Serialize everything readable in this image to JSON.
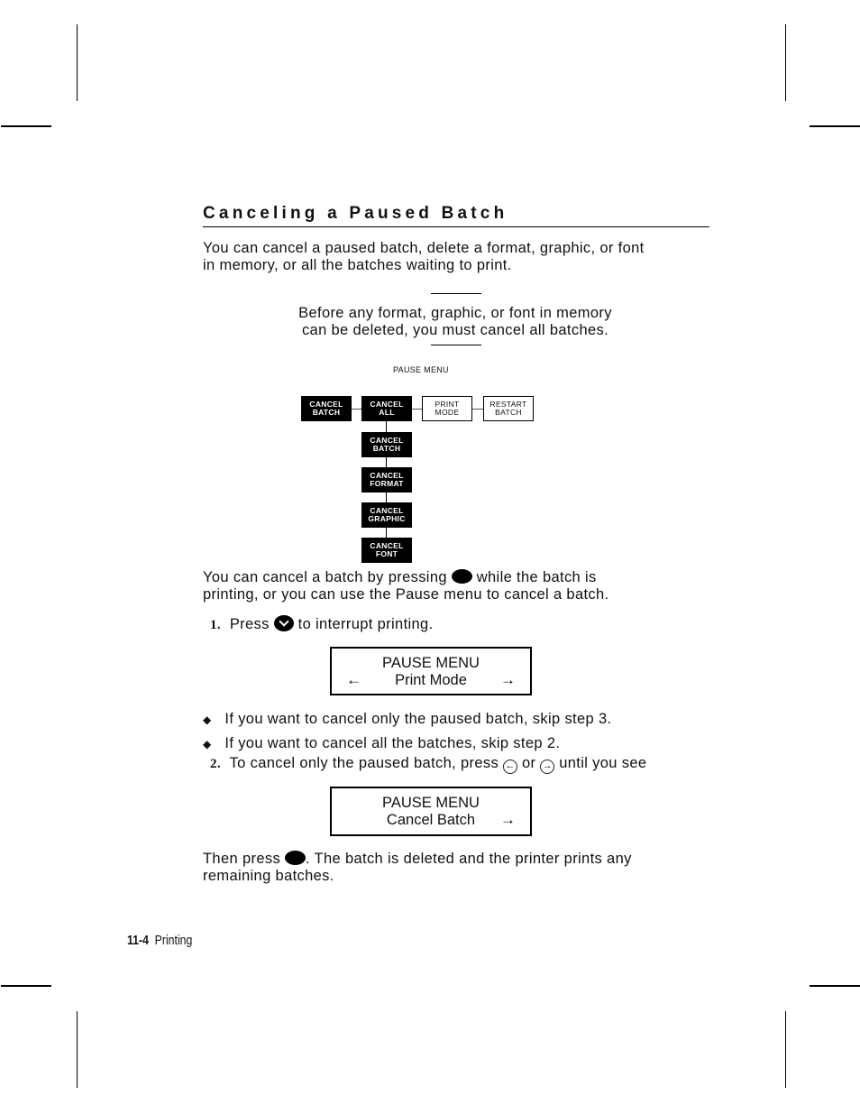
{
  "section": {
    "title": "Canceling a Paused Batch",
    "intro_line1": "You can cancel a paused batch, delete a format, graphic, or font",
    "intro_line2": "in memory, or all the batches waiting to print."
  },
  "note": {
    "line1": "Before any format, graphic, or font in memory",
    "line2": "can be deleted, you must cancel all batches."
  },
  "diagram": {
    "title": "PAUSE MENU",
    "top_row": [
      {
        "line1": "CANCEL",
        "line2": "BATCH",
        "style": "dark"
      },
      {
        "line1": "CANCEL",
        "line2": "ALL",
        "style": "dark"
      },
      {
        "line1": "PRINT",
        "line2": "MODE",
        "style": "light"
      },
      {
        "line1": "RESTART",
        "line2": "BATCH",
        "style": "light"
      }
    ],
    "sub_items": [
      {
        "line1": "CANCEL",
        "line2": "BATCH"
      },
      {
        "line1": "CANCEL",
        "line2": "FORMAT"
      },
      {
        "line1": "CANCEL",
        "line2": "GRAPHIC"
      },
      {
        "line1": "CANCEL",
        "line2": "FONT"
      }
    ]
  },
  "body": {
    "cancel_para_a": "You can cancel a batch by pressing",
    "cancel_para_b": "while the batch is",
    "cancel_para_line2": "printing, or you can use the Pause menu to cancel a batch.",
    "step1_num": "1.",
    "step1_a": "Press",
    "step1_b": "to interrupt printing.",
    "bullet1": "If you want to cancel only the paused batch, skip step 3.",
    "bullet2": "If you want to cancel all the batches, skip step 2.",
    "step2_num": "2.",
    "step2_a": "To cancel only the paused batch, press",
    "step2_or": "or",
    "step2_b": "until you see",
    "then_a": "Then press",
    "then_b": ".  The batch is deleted and the printer prints any",
    "then_line2": "remaining batches."
  },
  "lcd1": {
    "line1": "PAUSE MENU",
    "line2": "Print Mode",
    "left_arrow": "←",
    "right_arrow": "→"
  },
  "lcd2": {
    "line1": "PAUSE MENU",
    "line2": "Cancel Batch",
    "right_arrow": "→"
  },
  "icons": {
    "bullet": "◆",
    "left_key": "←",
    "right_key": "→"
  },
  "footer": {
    "page": "11-4",
    "chapter": "Printing"
  }
}
